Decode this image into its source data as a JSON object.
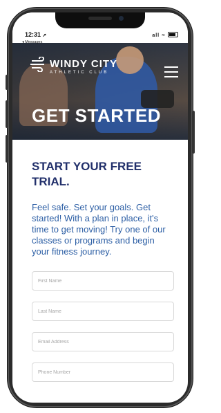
{
  "status_bar": {
    "time": "12:31",
    "back_app": "◂ Messages",
    "signal": "all"
  },
  "brand": {
    "name": "WINDY CITY",
    "tagline": "ATHLETIC CLUB"
  },
  "hero": {
    "title": "GET STARTED"
  },
  "main": {
    "heading": "START YOUR FREE TRIAL.",
    "description": "Feel safe. Set your goals. Get started! With a plan in place, it's time to get moving! Try one of our classes or programs and begin your fitness journey."
  },
  "form": {
    "first_name_placeholder": "First Name",
    "last_name_placeholder": "Last Name",
    "email_placeholder": "Email Address",
    "phone_placeholder": "Phone Number"
  },
  "colors": {
    "heading": "#22306b",
    "body_text": "#2d5fa5",
    "field_border": "#d8d8d8"
  },
  "icons": {
    "menu": "hamburger-icon",
    "logo": "wind-icon"
  }
}
